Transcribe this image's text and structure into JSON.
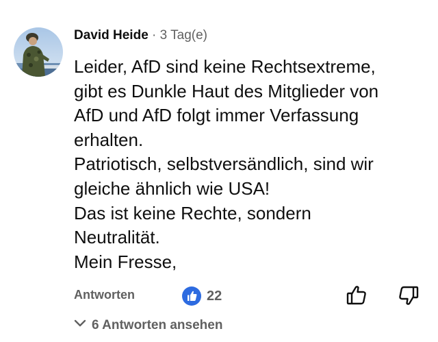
{
  "comment": {
    "author": "David Heide",
    "separator": "·",
    "time": "3 Tag(e)",
    "lines": [
      "Leider, AfD sind keine Rechtsextreme,",
      "gibt es Dunkle Haut des Mitglieder von",
      "AfD und AfD folgt immer Verfassung",
      "erhalten.",
      "Patriotisch, selbstversändlich, sind wir",
      "gleiche ähnlich wie USA!",
      "Das ist keine Rechte, sondern",
      "Neutralität.",
      "Mein Fresse,"
    ]
  },
  "actions": {
    "reply_label": "Antworten",
    "like_count": "22",
    "like_icon": "creator-heart-thumbs-up-icon",
    "thumb_up_icon": "thumb-up-icon",
    "thumb_down_icon": "thumb-down-icon"
  },
  "replies": {
    "label": "6 Antworten ansehen",
    "icon": "chevron-down-icon"
  },
  "colors": {
    "text_primary": "#0f0f0f",
    "text_secondary": "#606060",
    "like_badge": "#2d6be0"
  }
}
